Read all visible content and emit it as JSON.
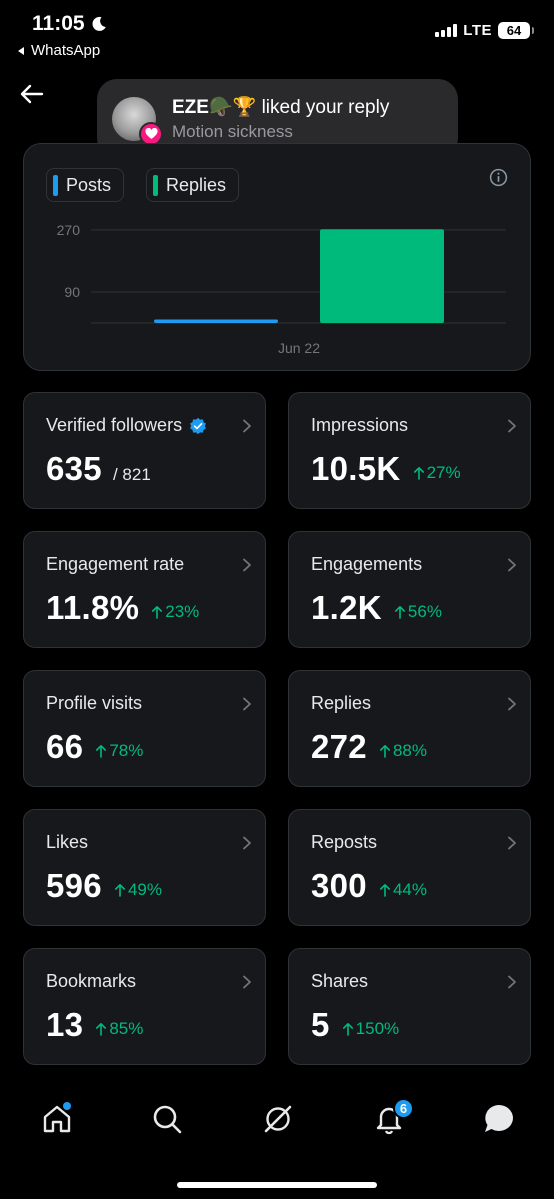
{
  "status_bar": {
    "time": "11:05",
    "back_app": "WhatsApp",
    "network": "LTE",
    "battery": "64"
  },
  "notification": {
    "name": "EZE🪖🏆",
    "action": "liked your reply",
    "subtitle": "Motion sickness"
  },
  "chart": {
    "legend": [
      {
        "label": "Posts",
        "color": "#1d9bf0"
      },
      {
        "label": "Replies",
        "color": "#00ba7c"
      }
    ]
  },
  "chart_data": {
    "type": "bar",
    "categories": [
      "Jun 22"
    ],
    "series": [
      {
        "name": "Posts",
        "values": [
          10
        ],
        "color": "#1d9bf0"
      },
      {
        "name": "Replies",
        "values": [
          272
        ],
        "color": "#00ba7c"
      }
    ],
    "y_ticks": [
      90,
      270
    ],
    "ylim": [
      0,
      290
    ],
    "grid": true,
    "legend_position": "top-left"
  },
  "metrics": [
    {
      "label": "Verified followers",
      "value": "635",
      "total": "/ 821",
      "change": "",
      "verified": true
    },
    {
      "label": "Impressions",
      "value": "10.5K",
      "total": "",
      "change": "27%"
    },
    {
      "label": "Engagement rate",
      "value": "11.8%",
      "total": "",
      "change": "23%"
    },
    {
      "label": "Engagements",
      "value": "1.2K",
      "total": "",
      "change": "56%"
    },
    {
      "label": "Profile visits",
      "value": "66",
      "total": "",
      "change": "78%"
    },
    {
      "label": "Replies",
      "value": "272",
      "total": "",
      "change": "88%"
    },
    {
      "label": "Likes",
      "value": "596",
      "total": "",
      "change": "49%"
    },
    {
      "label": "Reposts",
      "value": "300",
      "total": "",
      "change": "44%"
    },
    {
      "label": "Bookmarks",
      "value": "13",
      "total": "",
      "change": "85%"
    },
    {
      "label": "Shares",
      "value": "5",
      "total": "",
      "change": "150%"
    }
  ],
  "bottom_nav": {
    "items": [
      "home-icon",
      "search-icon",
      "grok-icon",
      "bell-icon",
      "messages-icon"
    ],
    "notification_count": "6"
  },
  "colors": {
    "accent": "#1d9bf0",
    "positive": "#00ba7c",
    "card_bg": "#16181c",
    "card_border": "#2f3336"
  }
}
